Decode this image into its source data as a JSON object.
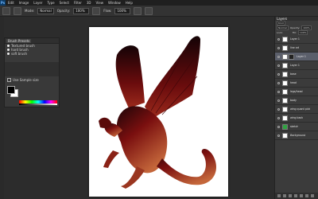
{
  "menubar": {
    "logo": "Ps",
    "items": [
      "Edit",
      "Image",
      "Layer",
      "Type",
      "Select",
      "Filter",
      "3D",
      "View",
      "Window",
      "Help"
    ]
  },
  "options": {
    "mode_label": "Mode:",
    "mode_value": "Normal",
    "opacity_label": "Opacity:",
    "opacity_value": "100%",
    "flow_label": "Flow:",
    "flow_value": "100%"
  },
  "brush_panel": {
    "tabs": [
      "Brush Presets"
    ],
    "presets": [
      "Textured brush",
      "hard brush",
      "soft brush"
    ],
    "checkbox_label": "Use Sample size"
  },
  "layers": {
    "title": "Layers",
    "kind_label": "Kind",
    "blend_mode": "Normal",
    "opacity_label": "Opacity:",
    "opacity_value": "100%",
    "lock_label": "Lock:",
    "fill_label": "Fill:",
    "fill_value": "100%",
    "rows": [
      {
        "name": "Layer 1",
        "thumb": "white"
      },
      {
        "name": "line art",
        "thumb": "white"
      },
      {
        "name": "Layer 1",
        "thumb": "mask",
        "selected": true
      },
      {
        "name": "Layer 1",
        "thumb": "white"
      },
      {
        "name": "base",
        "thumb": "white"
      },
      {
        "name": "head",
        "thumb": "white"
      },
      {
        "name": "legs/head",
        "thumb": "white"
      },
      {
        "name": "body",
        "thumb": "white"
      },
      {
        "name": "wing quant pick",
        "thumb": "white"
      },
      {
        "name": "wing back",
        "thumb": "white"
      },
      {
        "name": "sketch",
        "thumb": "green"
      },
      {
        "name": "Background",
        "thumb": "white",
        "italic": true
      }
    ]
  },
  "colors": {
    "dragon_light": "#c4663a",
    "dragon_mid": "#7a0f0f",
    "dragon_dark": "#1a0508"
  }
}
